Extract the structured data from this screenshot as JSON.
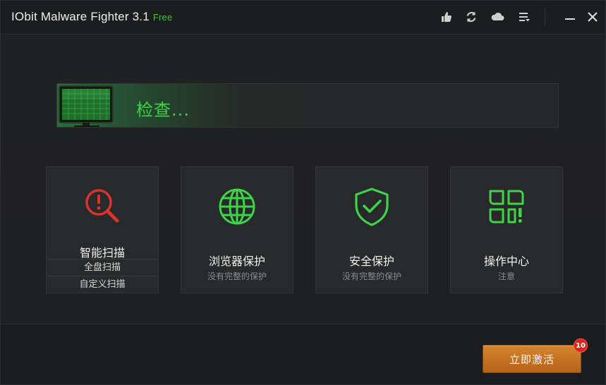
{
  "window": {
    "app_name": "IObit Malware Fighter 3.1",
    "edition": "Free"
  },
  "toolbar": {
    "icons": [
      "thumbs-up-icon",
      "refresh-icon",
      "cloud-icon",
      "menu-icon",
      "minimize-icon",
      "close-icon"
    ]
  },
  "status": {
    "text": "检查..."
  },
  "tiles": [
    {
      "id": "smart-scan",
      "title": "智能扫描",
      "icon": "scan-alert-icon",
      "sub_buttons": [
        "全盘扫描",
        "自定义扫描"
      ]
    },
    {
      "id": "browser-protection",
      "title": "浏览器保护",
      "subtitle": "没有完整的保护",
      "icon": "globe-icon"
    },
    {
      "id": "security-protection",
      "title": "安全保护",
      "subtitle": "没有完整的保护",
      "icon": "shield-check-icon"
    },
    {
      "id": "action-center",
      "title": "操作中心",
      "subtitle": "注意",
      "icon": "action-center-icon"
    }
  ],
  "footer": {
    "activate_label": "立即激活",
    "badge_count": "10"
  },
  "colors": {
    "accent_green": "#3fd24a",
    "alert_red": "#d9332b",
    "activate_orange": "#c9762a",
    "background": "#1e1f20"
  }
}
